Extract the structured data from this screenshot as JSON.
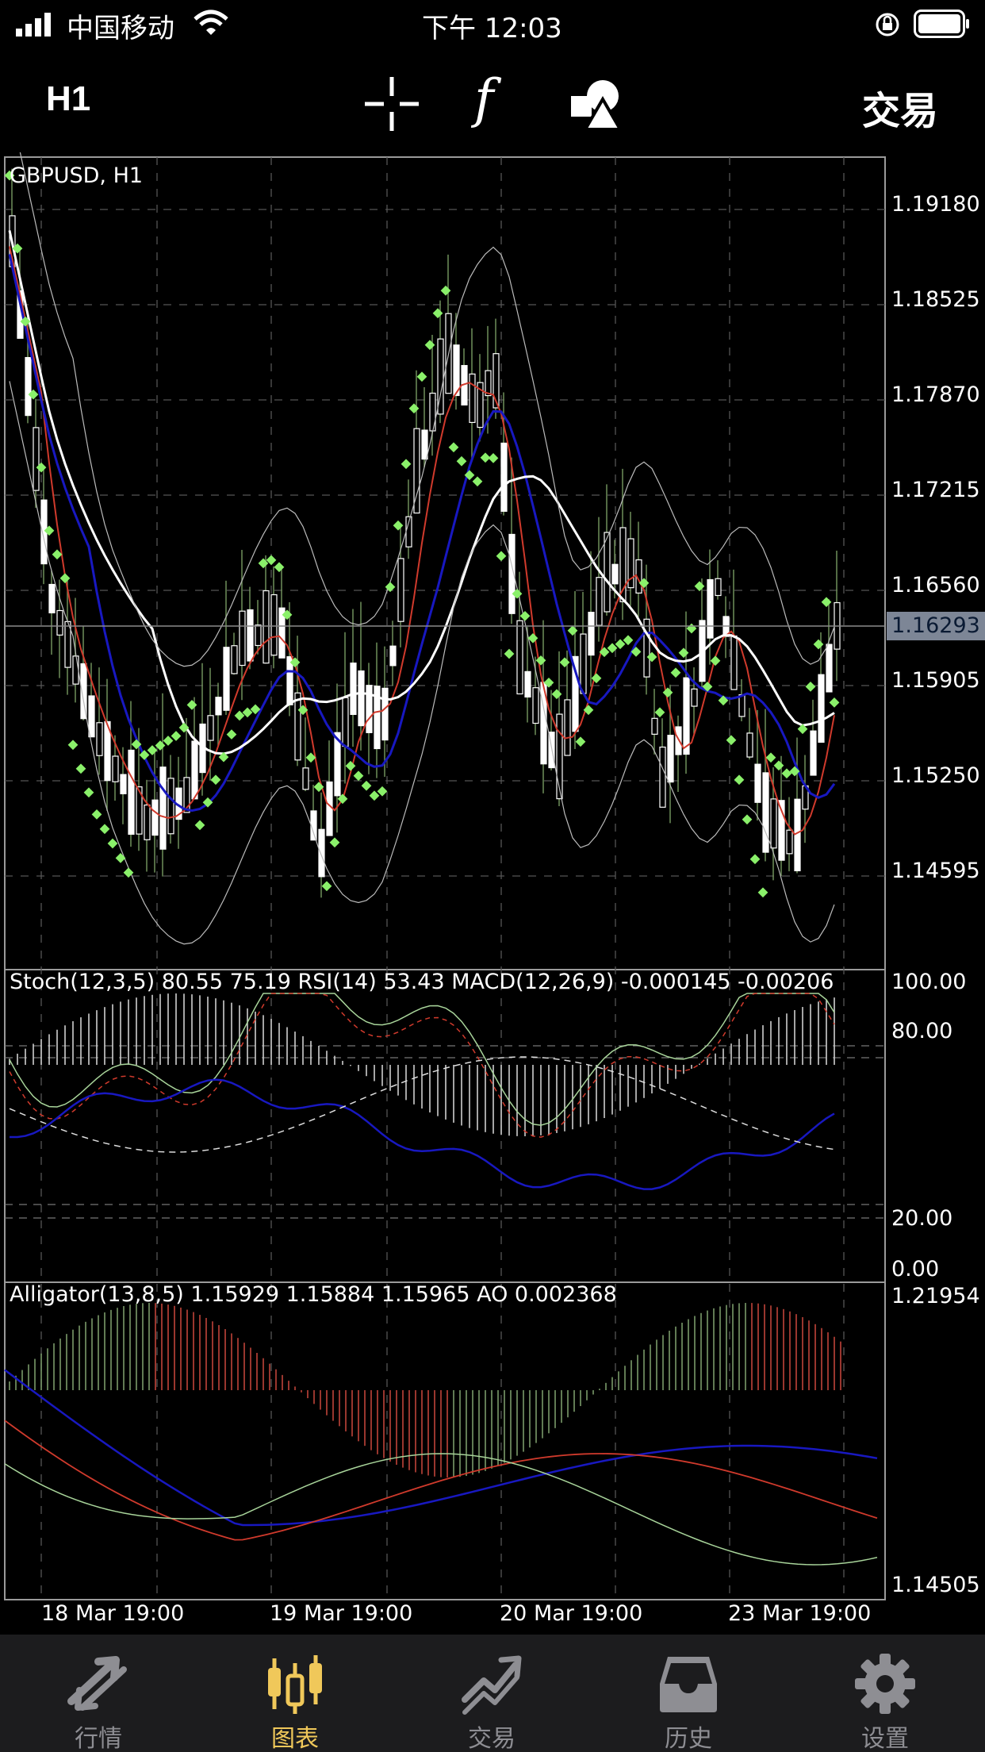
{
  "status_bar": {
    "carrier": "中国移动",
    "time": "下午 12:03"
  },
  "toolbar": {
    "timeframe": "H1",
    "function_symbol": "f",
    "trade_label": "交易"
  },
  "chart": {
    "symbol_label": "GBPUSD, H1",
    "current_price": "1.16293",
    "price_labels": [
      "1.19180",
      "1.18525",
      "1.17870",
      "1.17215",
      "1.16560",
      "1.15905",
      "1.15250",
      "1.14595"
    ],
    "stoch_header": "Stoch(12,3,5) 80.55 75.19 RSI(14) 53.43 MACD(12,26,9) -0.000145 -0.00206",
    "stoch_levels": [
      "100.00",
      "80.00",
      "20.00",
      "0.00"
    ],
    "alligator_header": "Alligator(13,8,5) 1.15929 1.15884 1.15965 AO 0.002368",
    "alligator_levels": [
      "1.21954",
      "1.14505"
    ],
    "x_labels": [
      "18 Mar 19:00",
      "19 Mar 19:00",
      "20 Mar 19:00",
      "23 Mar 19:00"
    ]
  },
  "tabs": [
    {
      "label": "行情",
      "icon": "quotes-arrows-icon",
      "active": false
    },
    {
      "label": "图表",
      "icon": "chart-candles-icon",
      "active": true
    },
    {
      "label": "交易",
      "icon": "trade-trend-icon",
      "active": false
    },
    {
      "label": "历史",
      "icon": "history-inbox-icon",
      "active": false
    },
    {
      "label": "设置",
      "icon": "settings-gear-icon",
      "active": false
    }
  ],
  "colors": {
    "accent": "#f0c85a",
    "candle_up": "#ffffff",
    "wick": "#6f8f5a",
    "sar": "#8af06a",
    "ma_red": "#d03a2c",
    "ma_blue": "#1818c0"
  }
}
